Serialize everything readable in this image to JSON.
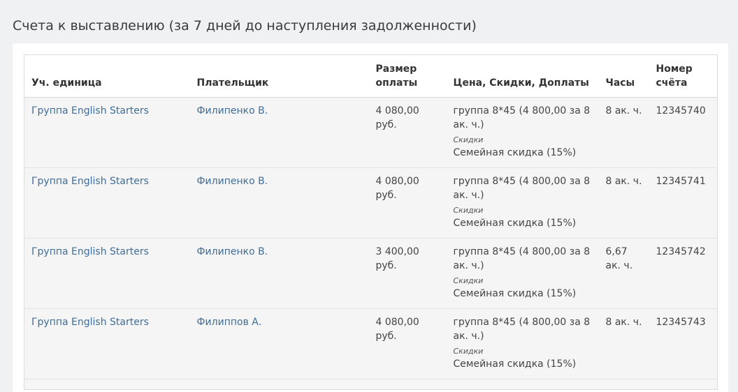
{
  "page": {
    "title": "Счета к выставлению (за 7 дней до наступления задолженности)"
  },
  "table": {
    "headers": {
      "unit": "Уч. единица",
      "payer": "Плательщик",
      "amount": "Размер оплаты",
      "price": "Цена, Скидки, Доплаты",
      "hours": "Часы",
      "invoice": "Номер счёта"
    },
    "rows": [
      {
        "unit": "Группа English Starters",
        "payer": "Филипенко В.",
        "amount": "4 080,00 руб.",
        "price": "группа 8*45 (4 800,00 за 8 ак. ч.)",
        "discount_label": "Скидки",
        "discount": "Семейная скидка (15%)",
        "hours": "8 ак. ч.",
        "invoice": "12345740"
      },
      {
        "unit": "Группа English Starters",
        "payer": "Филипенко В.",
        "amount": "4 080,00 руб.",
        "price": "группа 8*45 (4 800,00 за 8 ак. ч.)",
        "discount_label": "Скидки",
        "discount": "Семейная скидка (15%)",
        "hours": "8 ак. ч.",
        "invoice": "12345741"
      },
      {
        "unit": "Группа English Starters",
        "payer": "Филипенко В.",
        "amount": "3 400,00 руб.",
        "price": "группа 8*45 (4 800,00 за 8 ак. ч.)",
        "discount_label": "Скидки",
        "discount": "Семейная скидка (15%)",
        "hours": "6,67 ак. ч.",
        "invoice": "12345742"
      },
      {
        "unit": "Группа English Starters",
        "payer": "Филиппов А.",
        "amount": "4 080,00 руб.",
        "price": "группа 8*45 (4 800,00 за 8 ак. ч.)",
        "discount_label": "Скидки",
        "discount": "Семейная скидка (15%)",
        "hours": "8 ак. ч.",
        "invoice": "12345743"
      }
    ]
  },
  "colors": {
    "link": "#3f6d99",
    "row_background": "#f5f5f5",
    "page_background": "#f0f1f3"
  }
}
